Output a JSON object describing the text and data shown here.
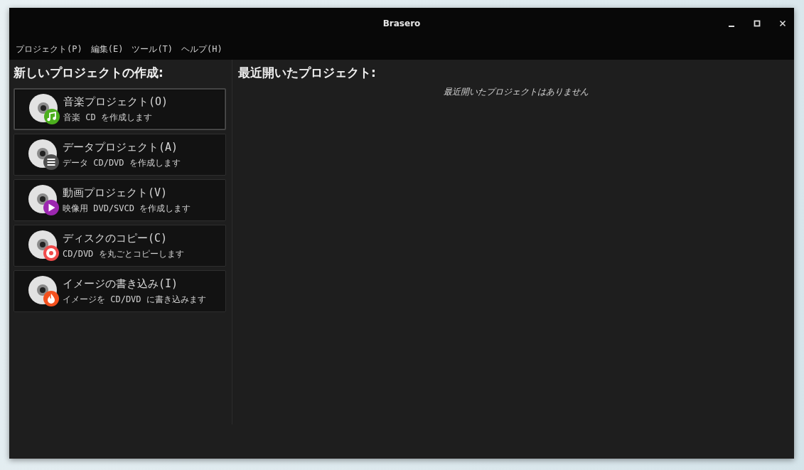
{
  "window": {
    "title": "Brasero"
  },
  "menu": [
    {
      "label": "プロジェクト(P)"
    },
    {
      "label": "編集(E)"
    },
    {
      "label": "ツール(T)"
    },
    {
      "label": "ヘルプ(H)"
    }
  ],
  "new_project": {
    "heading": "新しいプロジェクトの作成:",
    "items": [
      {
        "kind": "music",
        "title": "音楽プロジェクト(O)",
        "description": "音楽 CD を作成します",
        "color": "#4caf1e",
        "selected": true
      },
      {
        "kind": "data",
        "title": "データプロジェクト(A)",
        "description": "データ CD/DVD を作成します",
        "color": "#505050",
        "selected": false
      },
      {
        "kind": "video",
        "title": "動画プロジェクト(V)",
        "description": "映像用 DVD/SVCD を作成します",
        "color": "#9c27b0",
        "selected": false
      },
      {
        "kind": "copy",
        "title": "ディスクのコピー(C)",
        "description": "CD/DVD を丸ごとコピーします",
        "color": "#f04b4b",
        "selected": false
      },
      {
        "kind": "burn",
        "title": "イメージの書き込み(I)",
        "description": "イメージを CD/DVD に書き込みます",
        "color": "#f4511e",
        "selected": false
      }
    ]
  },
  "recent": {
    "heading": "最近開いたプロジェクト:",
    "empty_message": "最近開いたプロジェクトはありません"
  }
}
